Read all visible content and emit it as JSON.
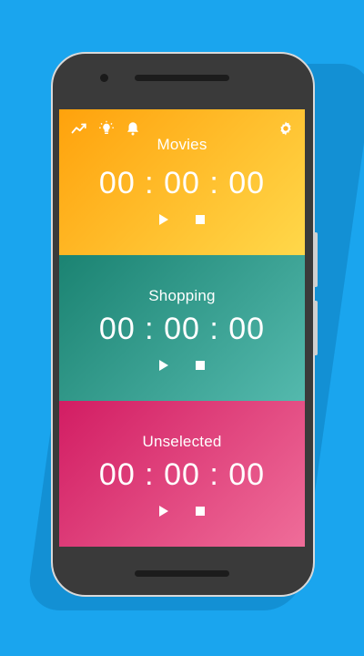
{
  "toolbar": {
    "icons": [
      "trending-icon",
      "lightbulb-icon",
      "bell-icon",
      "settings-icon"
    ]
  },
  "timers": [
    {
      "label": "Movies",
      "time": "00 : 00 : 00",
      "color_start": "#ffa20c",
      "color_end": "#ffd84a"
    },
    {
      "label": "Shopping",
      "time": "00 : 00 : 00",
      "color_start": "#1b8372",
      "color_end": "#54b9ad"
    },
    {
      "label": "Unselected",
      "time": "00 : 00 : 00",
      "color_start": "#d21d63",
      "color_end": "#ef6d99"
    }
  ],
  "colors": {
    "background": "#1aa5ee",
    "phone_body": "#3a3a3a"
  }
}
